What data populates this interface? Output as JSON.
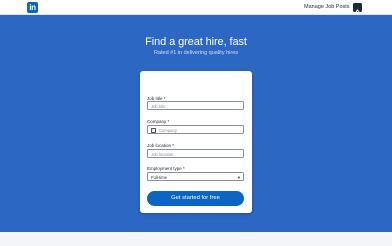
{
  "header": {
    "logo_text": "in",
    "manage_jobs": "Manage Job Posts"
  },
  "hero": {
    "title": "Find a great hire, fast",
    "subtitle": "Rated #1 in delivering quality hires"
  },
  "form": {
    "job_title": {
      "label": "Job title",
      "placeholder": "Job title"
    },
    "company": {
      "label": "Company",
      "placeholder": "Company"
    },
    "job_location": {
      "label": "Job location",
      "placeholder": "Job location"
    },
    "employment_type": {
      "label": "Employment type",
      "value": "Full-time"
    },
    "required_marker": "*",
    "submit_label": "Get started for free"
  },
  "colors": {
    "brand": "#0a66c2",
    "hero_bg": "#2c67c3"
  },
  "icons": {
    "logo": "linkedin-logo",
    "company_field": "building-icon",
    "dropdown": "chevron-down-icon",
    "account": "me-avatar"
  }
}
